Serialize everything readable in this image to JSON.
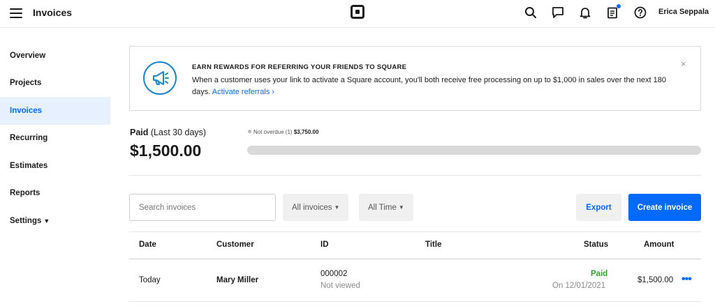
{
  "header": {
    "title": "Invoices",
    "user_name": "Erica Seppala",
    "icons": [
      "menu-icon",
      "square-logo-icon",
      "search-icon",
      "messages-icon",
      "notifications-icon",
      "clipboard-icon",
      "help-icon"
    ]
  },
  "sidebar": {
    "items": [
      {
        "label": "Overview"
      },
      {
        "label": "Projects"
      },
      {
        "label": "Invoices"
      },
      {
        "label": "Recurring"
      },
      {
        "label": "Estimates"
      },
      {
        "label": "Reports"
      },
      {
        "label": "Settings"
      }
    ],
    "active": "Invoices"
  },
  "banner": {
    "heading": "EARN REWARDS FOR REFERRING YOUR FRIENDS TO SQUARE",
    "body": "When a customer uses your link to activate a Square account, you'll both receive free processing on up to $1,000 in sales over the next 180 days.",
    "link": "Activate referrals",
    "close": "×",
    "icon": "megaphone-icon"
  },
  "summary": {
    "paid_label": "Paid",
    "period": "(Last 30 days)",
    "paid_amount": "$1,500.00",
    "legend_label": "Not overdue (1)",
    "legend_amount": "$3,750.00",
    "progress_fraction": 0
  },
  "toolbar": {
    "search_placeholder": "Search invoices",
    "filter_invoices": "All invoices",
    "filter_time": "All Time",
    "export_label": "Export",
    "create_label": "Create invoice"
  },
  "table": {
    "headers": {
      "date": "Date",
      "customer": "Customer",
      "id": "ID",
      "title": "Title",
      "status": "Status",
      "amount": "Amount"
    },
    "rows": [
      {
        "date": "Today",
        "customer": "Mary Miller",
        "id": "000002",
        "id_sub": "Not viewed",
        "title": "",
        "status": "Paid",
        "status_sub": "On 12/01/2021",
        "amount": "$1,500.00",
        "more": "•••"
      }
    ]
  },
  "colors": {
    "accent": "#006aff",
    "paid": "#2fa52f",
    "active_bg": "#e6f0ff"
  }
}
